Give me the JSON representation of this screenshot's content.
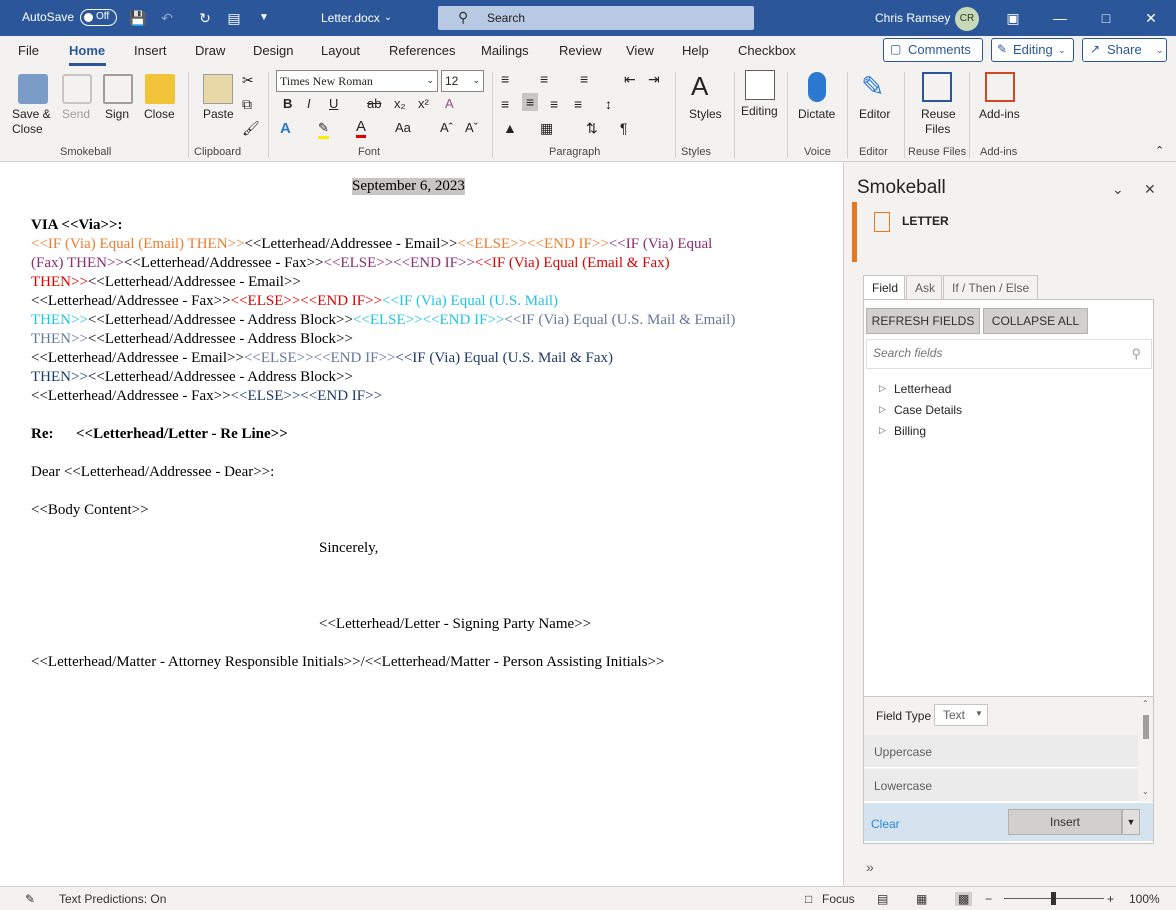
{
  "titlebar": {
    "autosave_label": "AutoSave",
    "autosave_state": "Off",
    "doc_title": "Letter.docx",
    "search_placeholder": "Search",
    "user_name": "Chris Ramsey",
    "user_initials": "CR"
  },
  "tabs": [
    "File",
    "Home",
    "Insert",
    "Draw",
    "Design",
    "Layout",
    "References",
    "Mailings",
    "Review",
    "View",
    "Help",
    "Checkbox"
  ],
  "active_tab": "Home",
  "actions": {
    "comments": "Comments",
    "editing": "Editing",
    "share": "Share"
  },
  "ribbon": {
    "smokeball": {
      "save_close_1": "Save &",
      "save_close_2": "Close",
      "send": "Send",
      "sign": "Sign",
      "close": "Close",
      "label": "Smokeball"
    },
    "clipboard": {
      "paste": "Paste",
      "label": "Clipboard"
    },
    "font": {
      "name": "Times New Roman",
      "size": "12",
      "label": "Font"
    },
    "paragraph": {
      "label": "Paragraph"
    },
    "styles": {
      "styles": "Styles",
      "label": "Styles"
    },
    "editing": {
      "editing": "Editing"
    },
    "voice": {
      "dictate": "Dictate",
      "label": "Voice"
    },
    "editor": {
      "editor": "Editor",
      "label": "Editor"
    },
    "reuse": {
      "reuse_1": "Reuse",
      "reuse_2": "Files",
      "label": "Reuse Files"
    },
    "addins": {
      "addins": "Add-ins",
      "label": "Add-ins"
    }
  },
  "document": {
    "date": "September 6, 2023",
    "via_heading": "VIA <<Via>>:",
    "lines": [
      [
        [
          "<<IF (Via) Equal (Email) THEN>>",
          "c-org"
        ],
        [
          "<<Letterhead/Addressee - Email>>",
          ""
        ],
        [
          "<<ELSE>><<END IF>>",
          "c-org"
        ],
        [
          "<<IF (Via) Equal",
          "c-pur"
        ]
      ],
      [
        [
          "(Fax) THEN>>",
          "c-pur"
        ],
        [
          "<<Letterhead/Addressee - Fax>>",
          ""
        ],
        [
          "<<ELSE>><<END IF>>",
          "c-pur"
        ],
        [
          "<<IF (Via) Equal (Email & Fax)",
          "c-red"
        ]
      ],
      [
        [
          "THEN>>",
          "c-red"
        ],
        [
          "<<Letterhead/Addressee - Email>>",
          ""
        ]
      ],
      [
        [
          "<<Letterhead/Addressee - Fax>>",
          ""
        ],
        [
          "<<ELSE>><<END IF>>",
          "c-red"
        ],
        [
          "<<IF (Via) Equal (U.S. Mail)",
          "c-cyan"
        ]
      ],
      [
        [
          "THEN>>",
          "c-cyan"
        ],
        [
          "<<Letterhead/Addressee - Address Block>>",
          ""
        ],
        [
          "<<ELSE>><<END IF>>",
          "c-cyan"
        ],
        [
          "<<IF (Via) Equal (U.S. Mail & Email)",
          "c-slate"
        ]
      ],
      [
        [
          "THEN>>",
          "c-slate"
        ],
        [
          "<<Letterhead/Addressee - Address Block>>",
          ""
        ]
      ],
      [
        [
          "<<Letterhead/Addressee - Email>>",
          ""
        ],
        [
          "<<ELSE>><<END IF>>",
          "c-slate"
        ],
        [
          "<<IF (Via) Equal (U.S. Mail & Fax)",
          "c-navy"
        ]
      ],
      [
        [
          "THEN>>",
          "c-navy"
        ],
        [
          "<<Letterhead/Addressee - Address Block>>",
          ""
        ]
      ],
      [
        [
          "<<Letterhead/Addressee - Fax>>",
          ""
        ],
        [
          "<<ELSE>><<END IF>>",
          "c-navy"
        ]
      ]
    ],
    "re_label": "Re:",
    "re_value": "<<Letterhead/Letter - Re Line>>",
    "dear": "Dear <<Letterhead/Addressee - Dear>>:",
    "body": "<<Body Content>>",
    "sincerely": "Sincerely,",
    "signing": "<<Letterhead/Letter - Signing Party Name>>",
    "initials": "<<Letterhead/Matter - Attorney Responsible Initials>>/<<Letterhead/Matter - Person Assisting Initials>>"
  },
  "pane": {
    "title": "Smokeball",
    "letter_label": "LETTER",
    "tabs": [
      "Field",
      "Ask",
      "If / Then / Else"
    ],
    "refresh": "REFRESH FIELDS",
    "collapse": "COLLAPSE ALL",
    "search_placeholder": "Search fields",
    "tree": [
      "Letterhead",
      "Case Details",
      "Billing"
    ],
    "field_type_label": "Field Type",
    "field_type_value": "Text",
    "options": [
      "Uppercase",
      "Lowercase"
    ],
    "clear": "Clear",
    "insert": "Insert"
  },
  "status": {
    "predictions": "Text Predictions: On",
    "focus": "Focus",
    "zoom": "100%"
  }
}
